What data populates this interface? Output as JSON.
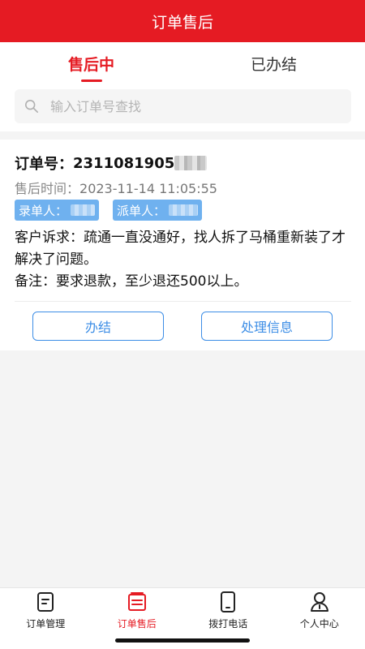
{
  "header": {
    "title": "订单售后"
  },
  "tabs": [
    {
      "label": "售后中",
      "active": true
    },
    {
      "label": "已办结",
      "active": false
    }
  ],
  "search": {
    "placeholder": "输入订单号查找",
    "value": ""
  },
  "order": {
    "number_label": "订单号：",
    "number_visible": "2311081905",
    "time_label": "售后时间：",
    "time_value": "2023-11-14 11:05:55",
    "recorder_label": "录单人：",
    "dispatcher_label": "派单人：",
    "complaint_label": "客户诉求：",
    "complaint_text": "疏通一直没通好，找人拆了马桶重新装了才解决了问题。",
    "remark_label": "备注：",
    "remark_text": "要求退款，至少退还500以上。",
    "buttons": {
      "close": "办结",
      "handle": "处理信息"
    }
  },
  "bottom_nav": [
    {
      "label": "订单管理",
      "icon": "order-manage-icon",
      "active": false
    },
    {
      "label": "订单售后",
      "icon": "after-sale-icon",
      "active": true
    },
    {
      "label": "拨打电话",
      "icon": "phone-icon",
      "active": false
    },
    {
      "label": "个人中心",
      "icon": "user-icon",
      "active": false
    }
  ],
  "colors": {
    "brand": "#e51b23",
    "accent_blue": "#3d8ee6",
    "tag_blue": "#6fb1ef"
  }
}
